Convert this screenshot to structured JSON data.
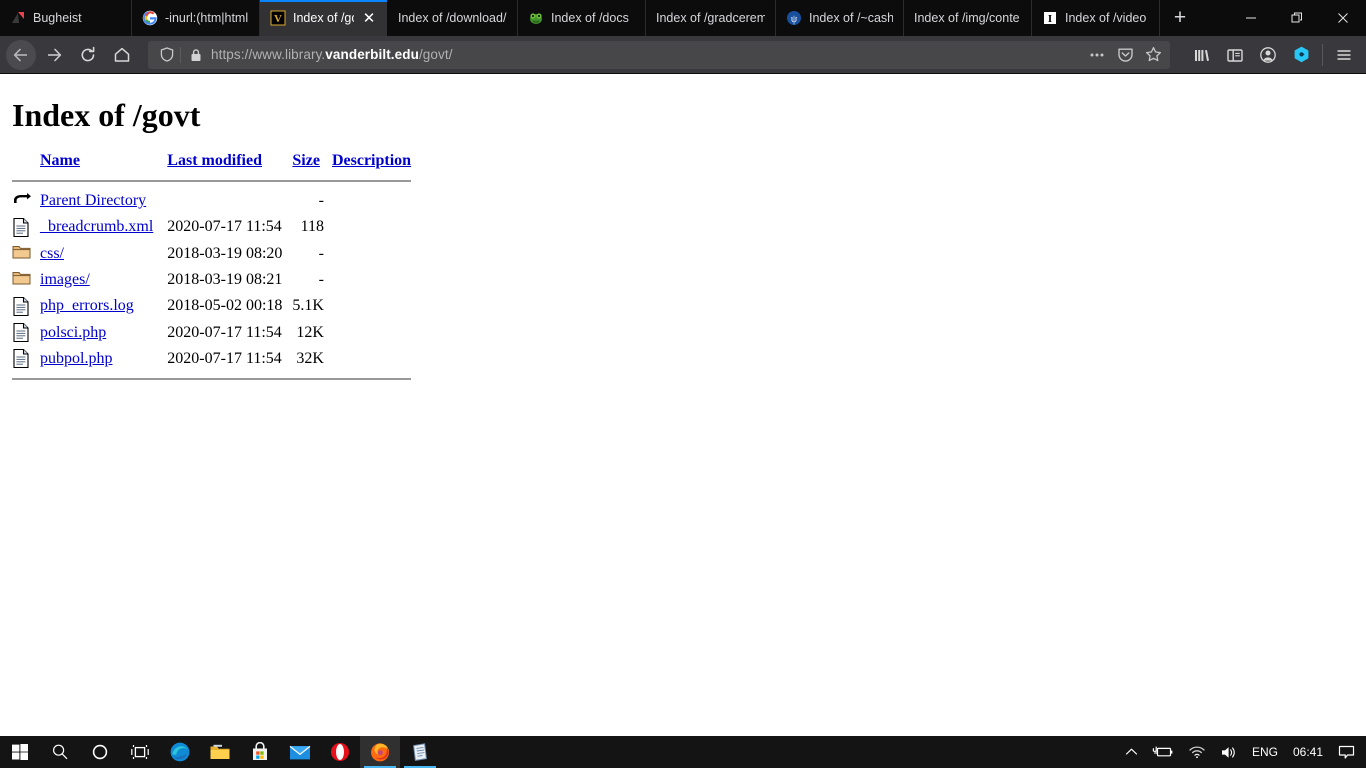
{
  "window": {
    "controls": {
      "minimize": "minimize-button",
      "restore": "restore-button",
      "close": "close-button"
    }
  },
  "tabs": [
    {
      "title": "Bugheist",
      "favicon": "bugheist-logo",
      "active": false
    },
    {
      "title": "-inurl:(htm|html|",
      "favicon": "google-icon",
      "active": false
    },
    {
      "title": "Index of /go",
      "favicon": "vanderbilt-v-icon",
      "active": true
    },
    {
      "title": "Index of /download/",
      "favicon": "none",
      "active": false
    },
    {
      "title": "Index of /docs",
      "favicon": "green-creature-icon",
      "active": false
    },
    {
      "title": "Index of /gradcerem",
      "favicon": "none",
      "active": false
    },
    {
      "title": "Index of /~cash/",
      "favicon": "blue-psi-icon",
      "active": false
    },
    {
      "title": "Index of /img/conte",
      "favicon": "none",
      "active": false
    },
    {
      "title": "Index of /video",
      "favicon": "letter-i-icon",
      "active": false
    }
  ],
  "newtab_label": "+",
  "toolbar": {
    "back": "Back",
    "forward": "Forward",
    "reload": "Reload",
    "home": "Home",
    "url_prefix": "https://www.library.",
    "url_host": "vanderbilt.edu",
    "url_suffix": "/govt/",
    "url_full": "https://www.library.vanderbilt.edu/govt/",
    "page_actions_label": "…",
    "pocket_label": "Save to Pocket",
    "bookmark_label": "Bookmark this page",
    "library_label": "Library",
    "sidebar_label": "Sidebars",
    "account_label": "Account",
    "extension_label": "Extension",
    "menu_label": "Open menu"
  },
  "page": {
    "heading": "Index of /govt",
    "columns": {
      "icon": "",
      "name": "Name",
      "modified": "Last modified",
      "size": "Size",
      "description": "Description"
    },
    "rows": [
      {
        "icon": "parent-directory-icon",
        "name": "Parent Directory",
        "modified": "",
        "size": "-",
        "description": ""
      },
      {
        "icon": "xml-file-icon",
        "name": "_breadcrumb.xml",
        "modified": "2020-07-17 11:54",
        "size": "118",
        "description": ""
      },
      {
        "icon": "folder-icon",
        "name": "css/",
        "modified": "2018-03-19 08:20",
        "size": "-",
        "description": ""
      },
      {
        "icon": "folder-icon",
        "name": "images/",
        "modified": "2018-03-19 08:21",
        "size": "-",
        "description": ""
      },
      {
        "icon": "log-file-icon",
        "name": "php_errors.log",
        "modified": "2018-05-02 00:18",
        "size": "5.1K",
        "description": ""
      },
      {
        "icon": "php-file-icon",
        "name": "polsci.php",
        "modified": "2020-07-17 11:54",
        "size": "12K",
        "description": ""
      },
      {
        "icon": "php-file-icon",
        "name": "pubpol.php",
        "modified": "2020-07-17 11:54",
        "size": "32K",
        "description": ""
      }
    ]
  },
  "taskbar": {
    "items": [
      {
        "name": "start-button",
        "icon": "windows-logo-icon"
      },
      {
        "name": "search-button",
        "icon": "search-icon"
      },
      {
        "name": "cortana-button",
        "icon": "cortana-circle-icon"
      },
      {
        "name": "task-view-button",
        "icon": "task-view-icon"
      },
      {
        "name": "edge-button",
        "icon": "edge-icon"
      },
      {
        "name": "file-explorer-button",
        "icon": "folder-icon"
      },
      {
        "name": "microsoft-store-button",
        "icon": "store-icon"
      },
      {
        "name": "mail-button",
        "icon": "envelope-icon"
      },
      {
        "name": "opera-button",
        "icon": "opera-icon"
      },
      {
        "name": "firefox-button",
        "icon": "firefox-icon"
      },
      {
        "name": "notepad-button",
        "icon": "notepad-icon"
      }
    ],
    "tray": {
      "overflow": "show-hidden-icons",
      "battery": "battery-charging-icon",
      "network": "wifi-icon",
      "volume": "volume-icon",
      "language": "ENG",
      "clock": "06:41",
      "action_center": "notifications-icon"
    }
  }
}
